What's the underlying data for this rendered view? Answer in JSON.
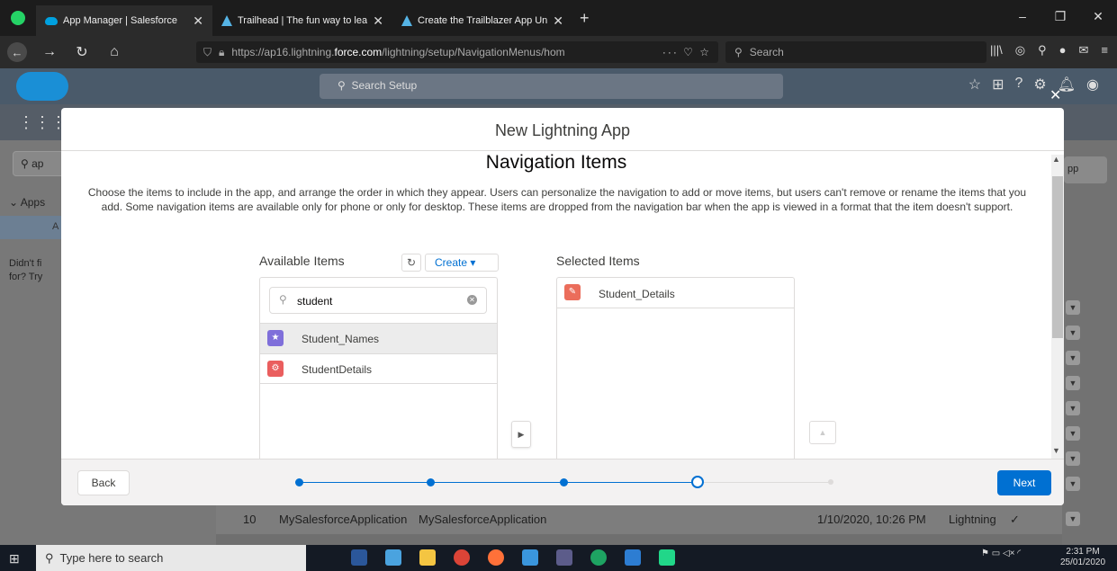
{
  "browser": {
    "tabs": [
      {
        "title": "App Manager | Salesforce",
        "active": true
      },
      {
        "title": "Trailhead | The fun way to learn"
      },
      {
        "title": "Create the Trailblazer App Unit"
      }
    ],
    "url_prefix": "https://ap16.lightning.",
    "url_host": "force.com",
    "url_path": "/lightning/setup/NavigationMenus/hom",
    "search_placeholder": "Search"
  },
  "salesforce": {
    "search_placeholder": "Search Setup",
    "sidebar": {
      "search_value": "ap",
      "apps_label": "Apps",
      "highlight_item": "A",
      "didnt_find": "Didn't fi",
      "didnt_find_2": "for? Try"
    },
    "right_button": "pp",
    "background_row": {
      "number": "10",
      "name": "MySalesforceApplication",
      "developer_name": "MySalesforceApplication",
      "last_modified": "1/10/2020, 10:26 PM",
      "app_type": "Lightning",
      "check": "✓"
    }
  },
  "modal": {
    "header_title": "New Lightning App",
    "section_title": "Navigation Items",
    "description": "Choose the items to include in the app, and arrange the order in which they appear. Users can personalize the navigation to add or move items, but users can't remove or rename the items that you add. Some navigation items are available only for phone or only for desktop. These items are dropped from the navigation bar when the app is viewed in a format that the item doesn't support.",
    "available_label": "Available Items",
    "create_label": "Create",
    "selected_label": "Selected Items",
    "search_value": "student",
    "available_items": [
      {
        "label": "Student_Names",
        "icon": "star-icon",
        "color": "#7f6fda"
      },
      {
        "label": "StudentDetails",
        "icon": "gears-icon",
        "color": "#ea5e5e"
      }
    ],
    "selected_items": [
      {
        "label": "Student_Details",
        "icon": "pencil-icon",
        "color": "#eb6d5b"
      }
    ],
    "back_label": "Back",
    "next_label": "Next",
    "progress": {
      "total_steps": 5,
      "current_step": 4
    }
  },
  "taskbar": {
    "search_placeholder": "Type here to search",
    "time": "2:31 PM",
    "date": "25/01/2020"
  },
  "colors": {
    "brand_blue": "#0070d2",
    "browser_dark": "#1c1c1c"
  }
}
